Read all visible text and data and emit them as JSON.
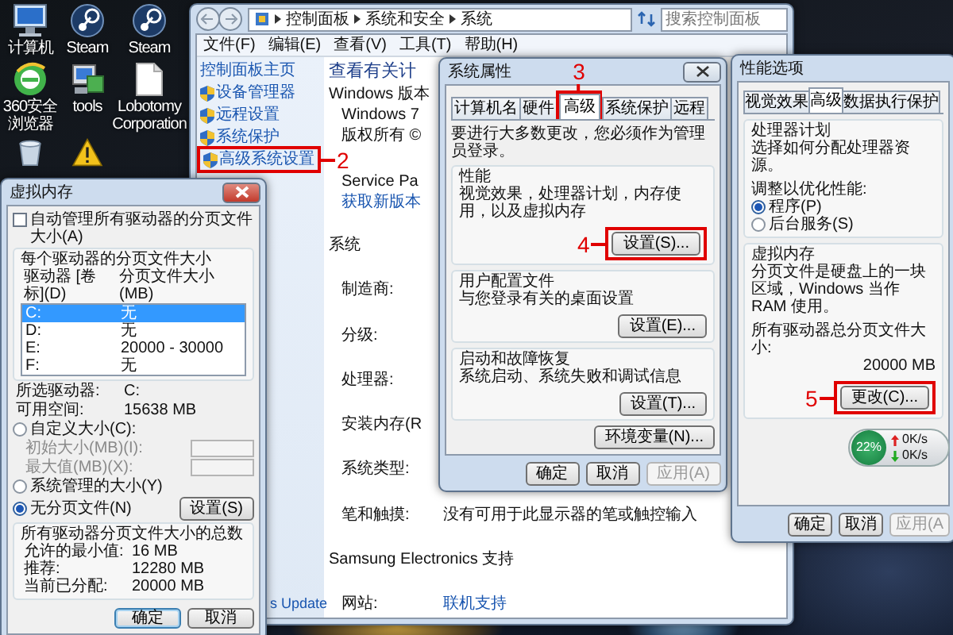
{
  "desktop_icons": [
    {
      "kind": "computer",
      "label": "计算机"
    },
    {
      "kind": "steam",
      "label": "Steam"
    },
    {
      "kind": "steam",
      "label": "Steam"
    },
    {
      "kind": "browser",
      "label": "360安全浏览器"
    },
    {
      "kind": "tools",
      "label": "tools"
    },
    {
      "kind": "file",
      "label": "Lobotomy Corporation"
    },
    {
      "kind": "recycle"
    },
    {
      "kind": "warning"
    }
  ],
  "control_panel": {
    "breadcrumb": [
      "控制面板",
      "系统和安全",
      "系统"
    ],
    "search": {
      "placeholder": "搜索控制面板"
    },
    "menu": [
      "文件(F)",
      "编辑(E)",
      "查看(V)",
      "工具(T)",
      "帮助(H)"
    ],
    "home_link": "控制面板主页",
    "tasks": [
      {
        "label": "设备管理器",
        "highlighted": false
      },
      {
        "label": "远程设置",
        "highlighted": false
      },
      {
        "label": "系统保护",
        "highlighted": false
      },
      {
        "label": "高级系统设置",
        "highlighted": true,
        "step": "2"
      }
    ],
    "bottom_link": "s Update",
    "heading": "查看有关计",
    "rows": [
      {
        "kind": "text",
        "text": "Windows 版本"
      },
      {
        "kind": "subtext",
        "text": "Windows 7"
      },
      {
        "kind": "subtext",
        "text": "版权所有 ©"
      },
      {
        "kind": "subtext",
        "text": "Service Pa"
      },
      {
        "kind": "link",
        "text": "获取新版本"
      },
      {
        "kind": "section",
        "text": "系统"
      },
      {
        "kind": "field",
        "label": "制造商:"
      },
      {
        "kind": "field",
        "label": "分级:"
      },
      {
        "kind": "field",
        "label": "处理器:"
      },
      {
        "kind": "field",
        "label": "安装内存(R"
      },
      {
        "kind": "field",
        "label": "系统类型:"
      },
      {
        "kind": "field",
        "label": "笔和触摸:",
        "value": "没有可用于此显示器的笔或触控输入"
      },
      {
        "kind": "section",
        "text": "Samsung Electronics 支持"
      },
      {
        "kind": "link_field",
        "label": "网站:",
        "value": "联机支持"
      }
    ]
  },
  "system_properties": {
    "title": "系统属性",
    "tabs": [
      {
        "label": "计算机名",
        "selected": false,
        "highlighted": false
      },
      {
        "label": "硬件",
        "selected": false,
        "highlighted": false
      },
      {
        "label": "高级",
        "selected": true,
        "highlighted": true,
        "step": "3"
      },
      {
        "label": "系统保护",
        "selected": false,
        "highlighted": false
      },
      {
        "label": "远程",
        "selected": false,
        "highlighted": false
      }
    ],
    "note": "要进行大多数更改，您必须作为管理员登录。",
    "groups": [
      {
        "title": "性能",
        "text": "视觉效果，处理器计划，内存使用，以及虚拟内存",
        "button": "设置(S)...",
        "highlighted": true,
        "step": "4"
      },
      {
        "title": "用户配置文件",
        "text": "与您登录有关的桌面设置",
        "button": "设置(E)...",
        "highlighted": false
      },
      {
        "title": "启动和故障恢复",
        "text": "系统启动、系统失败和调试信息",
        "button": "设置(T)...",
        "highlighted": false
      }
    ],
    "env_button": "环境变量(N)...",
    "buttons": [
      {
        "label": "确定",
        "disabled": false
      },
      {
        "label": "取消",
        "disabled": false
      },
      {
        "label": "应用(A)",
        "disabled": true
      }
    ]
  },
  "performance_options": {
    "title": "性能选项",
    "tabs": [
      {
        "label": "视觉效果",
        "selected": false
      },
      {
        "label": "高级",
        "selected": true
      },
      {
        "label": "数据执行保护",
        "selected": false
      }
    ],
    "processor": {
      "title": "处理器计划",
      "text": "选择如何分配处理器资源。",
      "adjust_label": "调整以优化性能:",
      "options": [
        {
          "label": "程序(P)",
          "selected": true
        },
        {
          "label": "后台服务(S)",
          "selected": false
        }
      ]
    },
    "memory": {
      "title": "虚拟内存",
      "text": "分页文件是硬盘上的一块区域，Windows 当作 RAM 使用。",
      "total_label": "所有驱动器总分页文件大小:",
      "total_value": "20000 MB",
      "button": "更改(C)...",
      "highlighted": true,
      "step": "5"
    },
    "buttons": [
      {
        "label": "确定",
        "disabled": false
      },
      {
        "label": "取消",
        "disabled": false
      },
      {
        "label": "应用(A",
        "disabled": true
      }
    ]
  },
  "net_gadget": {
    "percent": "22%",
    "rates": [
      {
        "kind": "up",
        "text": "0K/s"
      },
      {
        "kind": "down",
        "text": "0K/s"
      }
    ]
  },
  "virtual_memory": {
    "title": "虚拟内存",
    "auto_manage": {
      "label": "自动管理所有驱动器的分页文件大小(A)",
      "checked": false
    },
    "per_drive_title": "每个驱动器的分页文件大小",
    "columns": [
      "驱动器 [卷标](D)",
      "分页文件大小(MB)"
    ],
    "drives": [
      {
        "drive": "C:",
        "size": "无",
        "selected": true
      },
      {
        "drive": "D:",
        "size": "无",
        "selected": false
      },
      {
        "drive": "E:",
        "size": "20000 - 30000",
        "selected": false
      },
      {
        "drive": "F:",
        "size": "无",
        "selected": false
      }
    ],
    "info": [
      {
        "label": "所选驱动器:",
        "value": "C:"
      },
      {
        "label": "可用空间:",
        "value": "15638 MB"
      }
    ],
    "size_options": [
      {
        "label": "自定义大小(C):",
        "selected": false,
        "fields": [
          {
            "label": "初始大小(MB)(I):",
            "disabled": true
          },
          {
            "label": "最大值(MB)(X):",
            "disabled": true
          }
        ]
      },
      {
        "label": "系统管理的大小(Y)",
        "selected": false
      },
      {
        "label": "无分页文件(N)",
        "selected": true
      }
    ],
    "set_button": "设置(S)",
    "totals": {
      "title": "所有驱动器分页文件大小的总数",
      "rows": [
        {
          "label": "允许的最小值:",
          "value": "16 MB"
        },
        {
          "label": "推荐:",
          "value": "12280 MB"
        },
        {
          "label": "当前已分配:",
          "value": "20000 MB"
        }
      ]
    },
    "buttons": [
      {
        "label": "确定",
        "default": true
      },
      {
        "label": "取消",
        "default": false
      }
    ]
  }
}
